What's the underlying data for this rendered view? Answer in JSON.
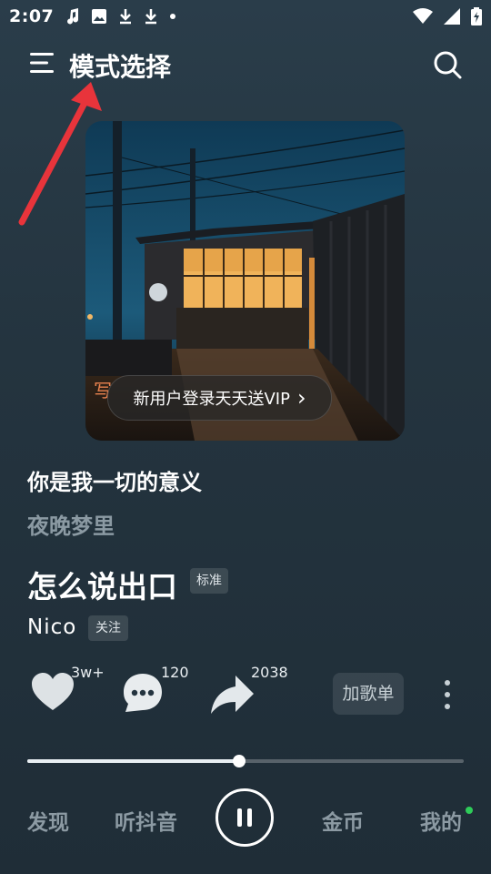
{
  "status_bar": {
    "time": "2:07"
  },
  "header": {
    "title": "模式选择"
  },
  "cover": {
    "vip_text": "新用户登录天天送VIP",
    "vip_chevron": "›",
    "side_glyph": "写"
  },
  "lyrics": {
    "line1": "你是我一切的意义",
    "line2": "夜晚梦里"
  },
  "song": {
    "title": "怎么说出口",
    "quality": "标准",
    "artist": "Nico",
    "follow_label": "关注"
  },
  "actions": {
    "likes": "3w+",
    "comments": "120",
    "shares": "2038",
    "add_playlist": "加歌单"
  },
  "progress": {
    "played_fraction": 0.485,
    "buffered_fraction": 0.37
  },
  "bottom_nav": {
    "discover": "发现",
    "douyin": "听抖音",
    "coins": "金币",
    "mine": "我的"
  },
  "colors": {
    "accent_annotation": "#e8343b",
    "notification_dot": "#2ecc59"
  }
}
